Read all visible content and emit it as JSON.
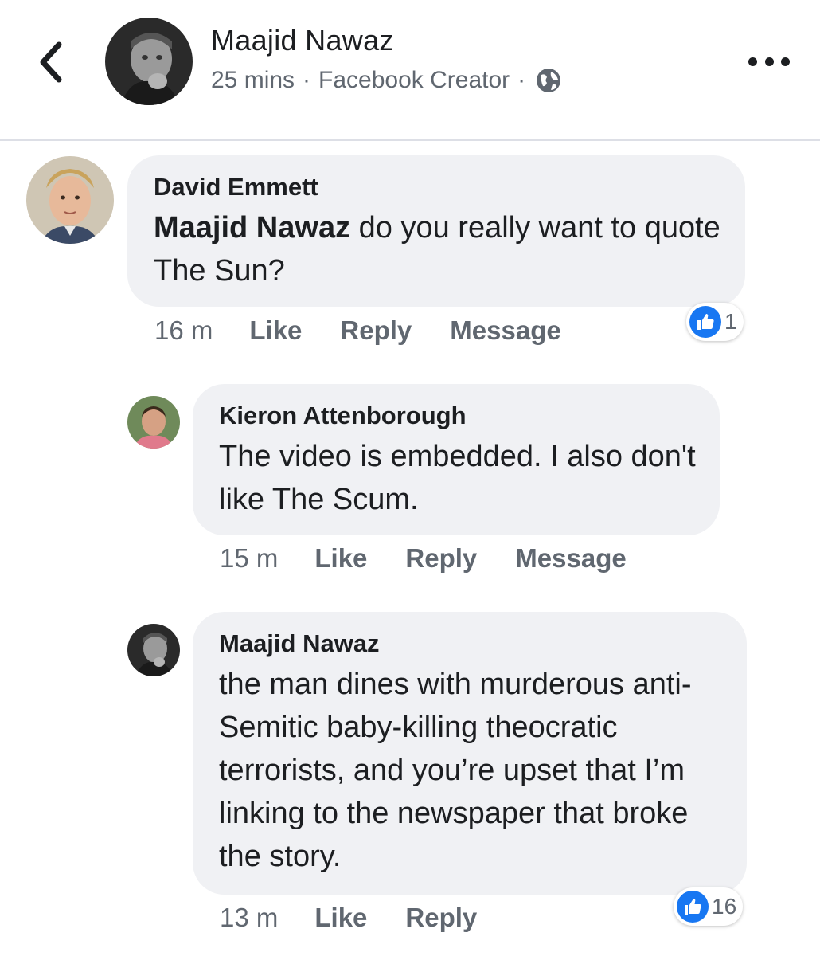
{
  "header": {
    "name": "Maajid Nawaz",
    "time": "25 mins",
    "separator": "·",
    "source": "Facebook Creator",
    "icons": {
      "back": "chevron-left-icon",
      "privacy": "globe-icon",
      "more": "more-icon"
    }
  },
  "comments": [
    {
      "author": "David Emmett",
      "mention": "Maajid Nawaz",
      "text": " do you really want to quote The Sun?",
      "time": "16 m",
      "like": "Like",
      "reply": "Reply",
      "message": "Message",
      "reactions": "1"
    },
    {
      "author": "Kieron Attenborough",
      "text": "The video is embedded. I also don't like The Scum.",
      "time": "15 m",
      "like": "Like",
      "reply": "Reply",
      "message": "Message"
    },
    {
      "author": "Maajid Nawaz",
      "text": "the man dines with murderous anti-Semitic baby-killing theocratic terrorists, and you’re upset that I’m linking to the newspaper that broke the story.",
      "time": "13 m",
      "like": "Like",
      "reply": "Reply",
      "reactions": "16"
    }
  ],
  "colors": {
    "like_blue": "#1877f2",
    "bubble": "#f0f1f4",
    "meta_gray": "#606770"
  }
}
